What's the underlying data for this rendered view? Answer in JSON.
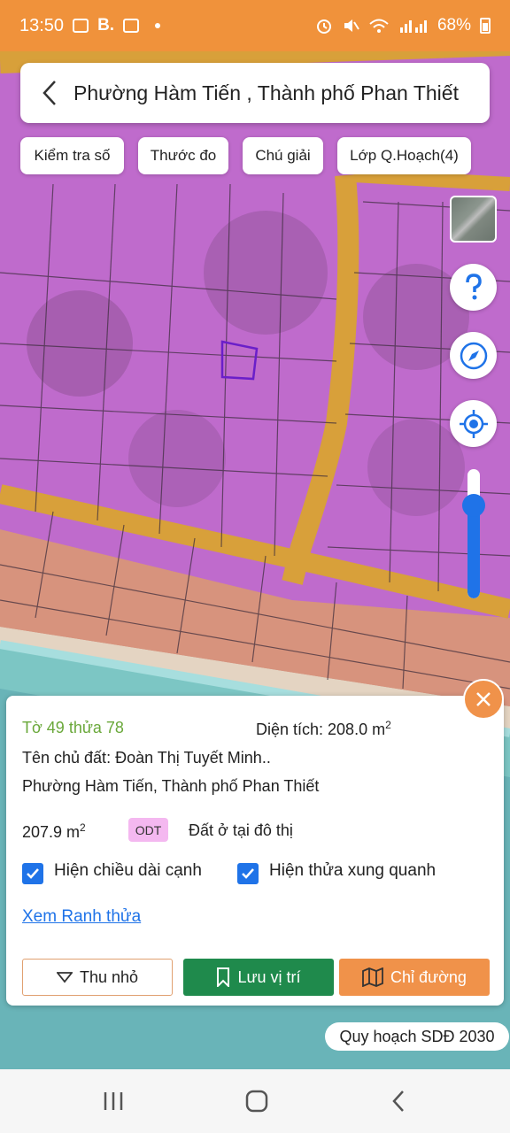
{
  "status_bar": {
    "time": "13:50",
    "b_indicator": "B.",
    "battery": "68%"
  },
  "header": {
    "title": "Phường Hàm Tiến , Thành phố Phan Thiết"
  },
  "toolbar": {
    "chips": [
      "Kiểm tra số",
      "Thước đo",
      "Chú giải",
      "Lớp Q.Hoạch(4)"
    ]
  },
  "map_controls": {
    "zoom_level_fraction": 0.72
  },
  "parcel": {
    "id_text": "Tờ 49 thửa 78",
    "area_label": "Diện tích: 208.0 m",
    "area_sup": "2",
    "owner": "Tên chủ đất: Đoàn Thị Tuyết Minh..",
    "address": "Phường Hàm Tiến, Thành phố Phan Thiết",
    "land_area": "207.9 m",
    "land_area_sup": "2",
    "land_code": "ODT",
    "land_type": "Đất ở tại đô thị"
  },
  "options": {
    "show_edge_lengths": "Hiện chiều dài cạnh",
    "show_neighbors": "Hiện thửa xung quanh"
  },
  "links": {
    "view_boundary": "Xem Ranh thửa"
  },
  "actions": {
    "collapse": "Thu nhỏ",
    "save_location": "Lưu vị trí",
    "directions": "Chỉ đường"
  },
  "plan_badge": "Quy hoạch SDĐ 2030",
  "colors": {
    "status_bar": "#f0923b",
    "accent_blue": "#1f73e8",
    "save_green": "#1f8a4c",
    "directions_orange": "#f0924a",
    "odt_pink": "#f4b8f0",
    "parcel_id_green": "#6aa83a"
  }
}
